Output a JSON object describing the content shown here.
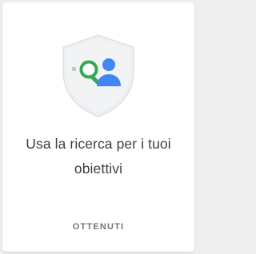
{
  "card": {
    "title": "Usa la ricerca per i tuoi obiettivi",
    "cta_label": "OTTENUTI"
  },
  "colors": {
    "shield_fill": "#eeeff1",
    "shield_stroke": "#ffffff",
    "magnifier": "#34a853",
    "person": "#4285f4",
    "title_text": "#3c4043",
    "cta_text": "#70757a"
  },
  "icons": {
    "illustration": "shield-icon",
    "search": "search-icon",
    "person": "person-icon"
  }
}
